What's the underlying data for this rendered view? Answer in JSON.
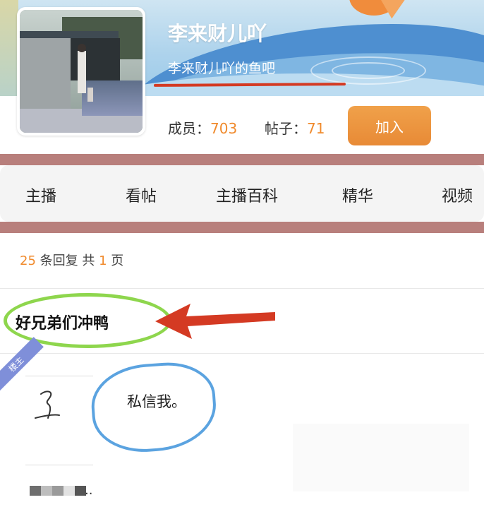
{
  "header": {
    "title": "李来财儿吖",
    "subtitle": "李来财儿吖的鱼吧",
    "members_label": "成员：",
    "members_count": "703",
    "posts_label": "帖子：",
    "posts_count": "71",
    "join_label": "加入"
  },
  "tabs": [
    {
      "label": "主播"
    },
    {
      "label": "看帖"
    },
    {
      "label": "主播百科"
    },
    {
      "label": "精华"
    },
    {
      "label": "视频"
    }
  ],
  "thread": {
    "reply_count": "25",
    "reply_text": "条回复 共",
    "page_count": "1",
    "page_unit": "页",
    "title": "好兄弟们冲鸭",
    "host_tag": "楼主",
    "post_body": "私信我。",
    "trailing": ".."
  },
  "colors": {
    "accent": "#f08a2c",
    "join_button": "#e88a36",
    "annotation_red": "#d43a23",
    "annotation_green": "#8ed64d",
    "annotation_blue": "#5ba3e0",
    "host_tag": "#7f8fd9"
  },
  "icons": {
    "avatar": "avatar-photo",
    "red_arrow": "arrow-left-icon",
    "signature": "signature-icon"
  }
}
